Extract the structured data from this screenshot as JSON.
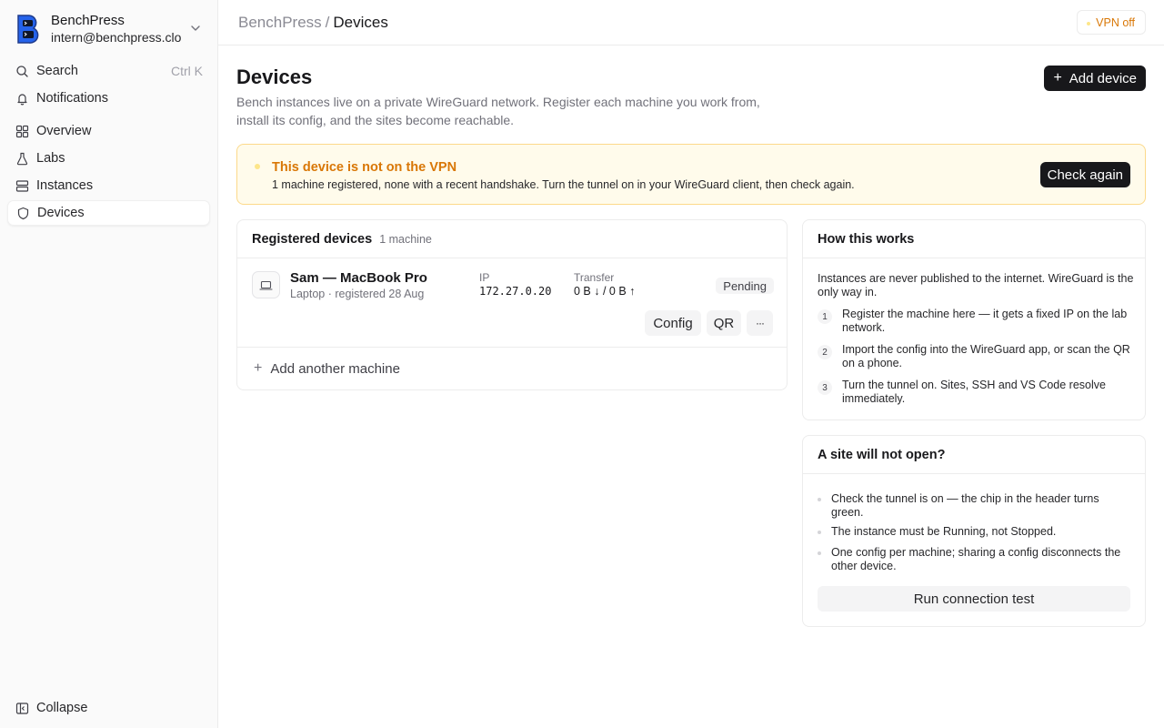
{
  "workspace": {
    "name": "BenchPress",
    "email": "intern@benchpress.cloud"
  },
  "sidebar": {
    "search": {
      "label": "Search",
      "shortcut": "Ctrl K"
    },
    "items": [
      {
        "label": "Notifications",
        "icon": "bell-icon"
      },
      {
        "label": "Overview",
        "icon": "grid-icon"
      },
      {
        "label": "Labs",
        "icon": "flask-icon"
      },
      {
        "label": "Instances",
        "icon": "server-icon"
      },
      {
        "label": "Devices",
        "icon": "shield-icon",
        "active": true
      }
    ],
    "collapse": "Collapse"
  },
  "header": {
    "crumb_root": "BenchPress",
    "crumb_sep": "/",
    "crumb_current": "Devices",
    "vpn_status": "VPN off"
  },
  "main": {
    "title": "Devices",
    "description": "Bench instances live on a private WireGuard network. Register each machine you work from, install its config, and the sites become reachable.",
    "add_device": "Add device",
    "alert": {
      "title": "This device is not on the VPN",
      "text": "1 machine registered, none with a recent handshake. Turn the tunnel on in your WireGuard client, then check again.",
      "action": "Check again"
    },
    "devices_card": {
      "title": "Registered devices",
      "count": "1 machine",
      "device": {
        "name": "Sam — MacBook Pro",
        "meta": "Laptop · registered 28 Aug",
        "ip_label": "IP",
        "ip": "172.27.0.20",
        "transfer_label": "Transfer",
        "transfer": "0 B ↓ / 0 B ↑",
        "status": "Pending",
        "config_btn": "Config",
        "qr_btn": "QR",
        "more_btn": "···"
      },
      "add_another": "Add another machine"
    },
    "how_card": {
      "title": "How this works",
      "intro": "Instances are never published to the internet. WireGuard is the only way in.",
      "steps": [
        {
          "n": "1",
          "text": "Register the machine here — it gets a fixed IP on the lab network."
        },
        {
          "n": "2",
          "text": "Import the config into the WireGuard app, or scan the QR on a phone."
        },
        {
          "n": "3",
          "text": "Turn the tunnel on. Sites, SSH and VS Code resolve immediately."
        }
      ]
    },
    "site_card": {
      "title": "A site will not open?",
      "tips": [
        "Check the tunnel is on — the chip in the header turns green.",
        "The instance must be Running, not Stopped.",
        "One config per machine; sharing a config disconnects the other device."
      ],
      "action": "Run connection test"
    }
  },
  "colors": {
    "accent_dark": "#18181b",
    "warning_text": "#d97706",
    "warning_bg": "#fffbeb",
    "warning_border": "#fcd98a"
  }
}
